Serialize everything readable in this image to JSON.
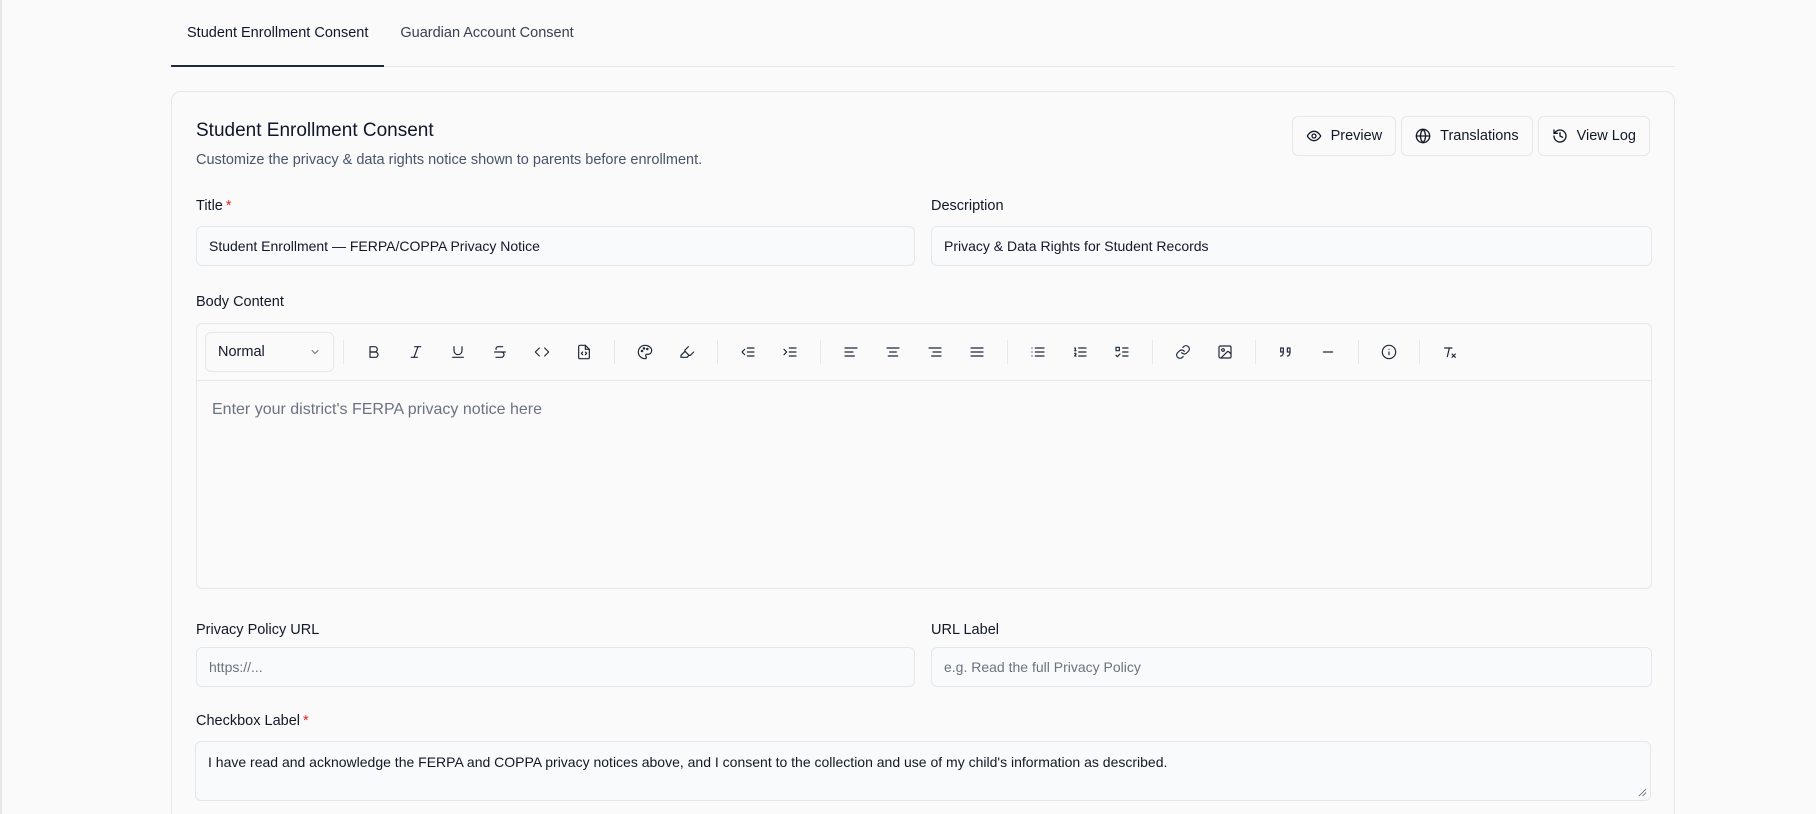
{
  "tabs": [
    {
      "label": "Student Enrollment Consent",
      "active": true
    },
    {
      "label": "Guardian Account Consent",
      "active": false
    }
  ],
  "card": {
    "title": "Student Enrollment Consent",
    "subtitle": "Customize the privacy & data rights notice shown to parents before enrollment.",
    "actions": {
      "preview": "Preview",
      "translations": "Translations",
      "view_log": "View Log"
    }
  },
  "form": {
    "title_label": "Title",
    "title_value": "Student Enrollment — FERPA/COPPA Privacy Notice",
    "description_label": "Description",
    "description_value": "Privacy & Data Rights for Student Records",
    "body_label": "Body Content",
    "editor": {
      "format_value": "Normal",
      "placeholder": "Enter your district's FERPA privacy notice here"
    },
    "privacy_url_label": "Privacy Policy URL",
    "privacy_url_placeholder": "https://...",
    "url_label_label": "URL Label",
    "url_label_placeholder": "e.g. Read the full Privacy Policy",
    "checkbox_label_label": "Checkbox Label",
    "checkbox_label_value": "I have read and acknowledge the FERPA and COPPA privacy notices above, and I consent to the collection and use of my child's information as described.",
    "required_marker": "*"
  },
  "colors": {
    "accent": "#1e293b",
    "required": "#dc2626",
    "border": "#e5e7eb"
  }
}
